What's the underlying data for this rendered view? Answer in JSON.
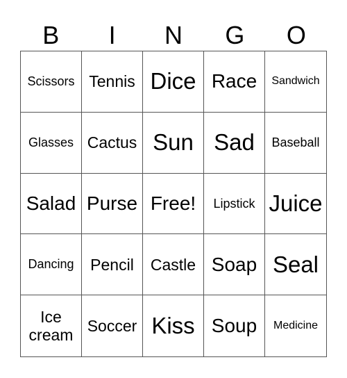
{
  "header": {
    "letters": [
      "B",
      "I",
      "N",
      "G",
      "O"
    ]
  },
  "board": {
    "rows": [
      [
        "Scissors",
        "Tennis",
        "Dice",
        "Race",
        "Sandwich"
      ],
      [
        "Glasses",
        "Cactus",
        "Sun",
        "Sad",
        "Baseball"
      ],
      [
        "Salad",
        "Purse",
        "Free!",
        "Lipstick",
        "Juice"
      ],
      [
        "Dancing",
        "Pencil",
        "Castle",
        "Soap",
        "Seal"
      ],
      [
        "Ice cream",
        "Soccer",
        "Kiss",
        "Soup",
        "Medicine"
      ]
    ]
  }
}
